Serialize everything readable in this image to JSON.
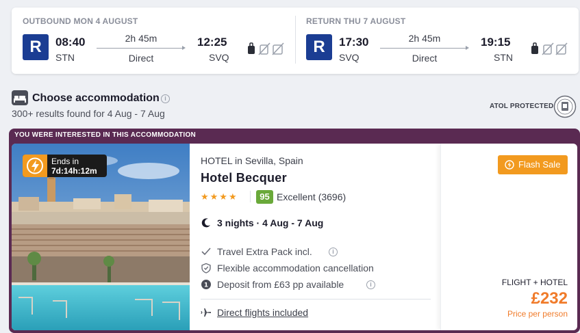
{
  "outbound": {
    "title": "OUTBOUND MON 4 AUGUST",
    "airline_logo": "R",
    "depart_time": "08:40",
    "depart_code": "STN",
    "duration": "2h 45m",
    "stops": "Direct",
    "arrive_time": "12:25",
    "arrive_code": "SVQ"
  },
  "return": {
    "title": "RETURN THU 7 AUGUST",
    "airline_logo": "R",
    "depart_time": "17:30",
    "depart_code": "SVQ",
    "duration": "2h 45m",
    "stops": "Direct",
    "arrive_time": "19:15",
    "arrive_code": "STN"
  },
  "accommodation": {
    "title": "Choose accommodation",
    "subtitle": "300+ results found for 4 Aug - 7 Aug",
    "atol": "ATOL PROTECTED"
  },
  "result": {
    "banner": "YOU WERE INTERESTED IN THIS ACCOMMODATION",
    "flash_ends_label": "Ends in",
    "flash_ends_time": "7d:14h:12m",
    "type_line": "HOTEL in Sevilla, Spain",
    "hotel_name": "Hotel Becquer",
    "stars": 4,
    "score": "95",
    "rating_text": "Excellent (3696)",
    "nights": "3 nights · 4 Aug - 7 Aug",
    "features": [
      "Travel Extra Pack incl.",
      "Flexible accommodation cancellation",
      "Deposit from £63 pp available"
    ],
    "direct_flights": "Direct flights included",
    "sale_badge": "Flash Sale",
    "price_label": "FLIGHT + HOTEL",
    "price": "£232",
    "price_per": "Price per person"
  },
  "colors": {
    "airline": "#1b3d93",
    "card_border": "#5a2a52",
    "accent": "#f29a1f",
    "price": "#f07b2a",
    "score": "#6aa93a"
  }
}
